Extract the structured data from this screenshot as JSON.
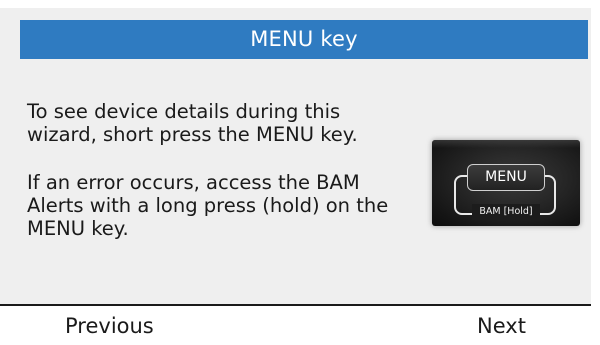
{
  "header": {
    "title": "MENU key"
  },
  "content": {
    "paragraph1": "To see device details during this wizard, short press the MENU key.",
    "paragraph2": "If an error occurs, access the BAM Alerts with a long press (hold) on the MENU key."
  },
  "illustration": {
    "key_label": "MENU",
    "sub_label": "BAM [Hold]"
  },
  "footer": {
    "previous_label": "Previous",
    "next_label": "Next"
  },
  "colors": {
    "title_bar": "#2f7bc1",
    "panel_background": "#efefef",
    "text": "#1a1a1a"
  }
}
